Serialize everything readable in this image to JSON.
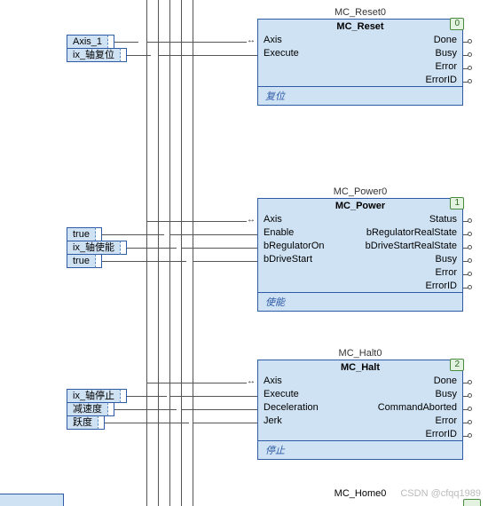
{
  "rails_x": [
    165,
    178,
    191,
    204,
    217
  ],
  "inputs": {
    "axis1": "Axis_1",
    "reset": "ix_轴复位",
    "true1": "true",
    "enable": "ix_轴使能",
    "true2": "true",
    "halt": "ix_轴停止",
    "decel": "减速度",
    "jerk": "跃度"
  },
  "blocks": {
    "reset": {
      "instance": "MC_Reset0",
      "type": "MC_Reset",
      "index": "0",
      "left": [
        "Axis",
        "Execute"
      ],
      "right": [
        "Done",
        "Busy",
        "Error",
        "ErrorID"
      ],
      "footer": "复位"
    },
    "power": {
      "instance": "MC_Power0",
      "type": "MC_Power",
      "index": "1",
      "left": [
        "Axis",
        "Enable",
        "bRegulatorOn",
        "bDriveStart"
      ],
      "right": [
        "Status",
        "bRegulatorRealState",
        "bDriveStartRealState",
        "Busy",
        "Error",
        "ErrorID"
      ],
      "footer": "使能"
    },
    "halt": {
      "instance": "MC_Halt0",
      "type": "MC_Halt",
      "index": "2",
      "left": [
        "Axis",
        "Execute",
        "Deceleration",
        "Jerk"
      ],
      "right": [
        "Done",
        "Busy",
        "CommandAborted",
        "Error",
        "ErrorID"
      ],
      "footer": "停止"
    },
    "home_instance": "MC_Home0"
  },
  "watermark": "CSDN @cfqq1989"
}
